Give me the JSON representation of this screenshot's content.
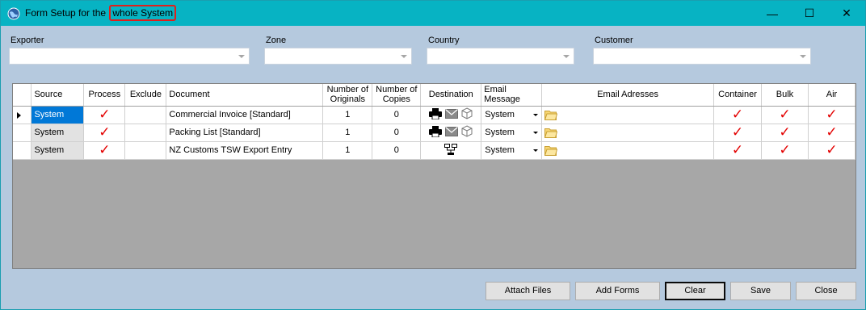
{
  "window": {
    "title_prefix": "Form Setup for the ",
    "title_highlight": "whole System",
    "min_label": "—",
    "max_label": "☐",
    "close_label": "✕"
  },
  "filters": {
    "exporter_label": "Exporter",
    "zone_label": "Zone",
    "country_label": "Country",
    "customer_label": "Customer"
  },
  "grid": {
    "columns": {
      "source": "Source",
      "process": "Process",
      "exclude": "Exclude",
      "document": "Document",
      "originals": "Number of Originals",
      "copies": "Number of Copies",
      "destination": "Destination",
      "email_message": "Email Message",
      "email_addresses": "Email Adresses",
      "container": "Container",
      "bulk": "Bulk",
      "air": "Air"
    },
    "rows": [
      {
        "source": "System",
        "document": "Commercial Invoice [Standard]",
        "originals": "1",
        "copies": "0",
        "email_message": "System",
        "destination_icons": [
          "printer-icon",
          "envelope-icon",
          "package-icon"
        ],
        "process": true,
        "container": true,
        "bulk": true,
        "air": true,
        "selected": true
      },
      {
        "source": "System",
        "document": "Packing List [Standard]",
        "originals": "1",
        "copies": "0",
        "email_message": "System",
        "destination_icons": [
          "printer-icon",
          "envelope-icon",
          "package-icon"
        ],
        "process": true,
        "container": true,
        "bulk": true,
        "air": true,
        "selected": false
      },
      {
        "source": "System",
        "document": "NZ Customs TSW Export Entry",
        "originals": "1",
        "copies": "0",
        "email_message": "System",
        "destination_icons": [
          "network-icon"
        ],
        "process": true,
        "container": true,
        "bulk": true,
        "air": true,
        "selected": false
      }
    ],
    "check_glyph": "✓"
  },
  "buttons": {
    "attach_files": "Attach Files",
    "add_forms": "Add Forms",
    "clear": "Clear",
    "save": "Save",
    "close": "Close"
  },
  "colors": {
    "titlebar": "#07b3c3",
    "body": "#b5c9de",
    "highlight_border": "#e0201b",
    "check": "#e30000",
    "selection": "#0078d7"
  }
}
